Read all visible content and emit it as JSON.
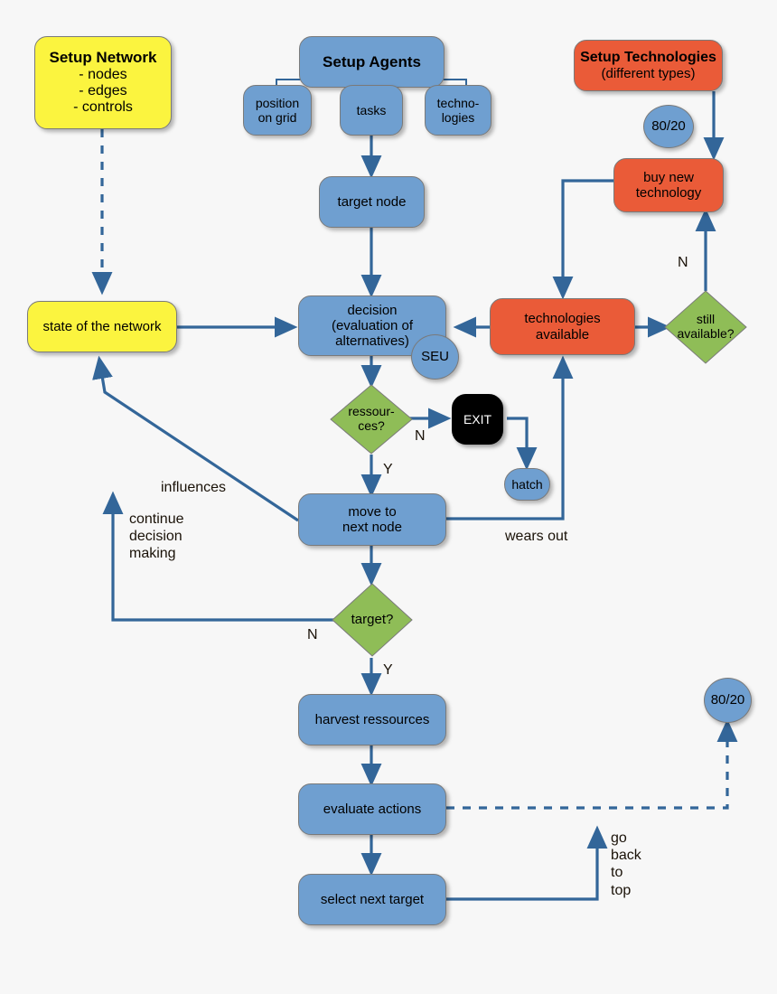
{
  "diagram": {
    "title_nodes": {
      "setup_network": {
        "title": "Setup Network",
        "lines": "- nodes\n- edges\n- controls"
      },
      "setup_agents": {
        "title": "Setup Agents"
      },
      "setup_technologies": {
        "title": "Setup Technologies",
        "sub": "(different types)"
      }
    },
    "nodes": [
      {
        "id": "setup-network",
        "label": "Setup Network",
        "shape": "rect",
        "color": "#fbf43f"
      },
      {
        "id": "setup-agents",
        "label": "Setup Agents",
        "shape": "rect",
        "color": "#6f9fd0"
      },
      {
        "id": "position-on-grid",
        "label": "position\non grid",
        "shape": "rect",
        "color": "#6f9fd0"
      },
      {
        "id": "tasks",
        "label": "tasks",
        "shape": "rect",
        "color": "#6f9fd0"
      },
      {
        "id": "technologies",
        "label": "techno-\nlogies",
        "shape": "rect",
        "color": "#6f9fd0"
      },
      {
        "id": "setup-technologies",
        "label": "Setup Technologies",
        "shape": "rect",
        "color": "#ea5b38"
      },
      {
        "id": "pareto-top",
        "label": "80/20",
        "shape": "circle",
        "color": "#6f9fd0"
      },
      {
        "id": "buy-new-technology",
        "label": "buy new\ntechnology",
        "shape": "rect",
        "color": "#ea5b38"
      },
      {
        "id": "target-node",
        "label": "target node",
        "shape": "rect",
        "color": "#6f9fd0"
      },
      {
        "id": "state-of-network",
        "label": "state of the network",
        "shape": "rect",
        "color": "#fbf43f"
      },
      {
        "id": "decision",
        "label": "decision\n(evaluation of\nalternatives)",
        "shape": "rect",
        "color": "#6f9fd0"
      },
      {
        "id": "seu",
        "label": "SEU",
        "shape": "circle",
        "color": "#6f9fd0"
      },
      {
        "id": "technologies-available",
        "label": "technologies\navailable",
        "shape": "rect",
        "color": "#ea5b38"
      },
      {
        "id": "still-available",
        "label": "still\navailable?",
        "shape": "diamond",
        "color": "#8fbd57"
      },
      {
        "id": "ressources",
        "label": "ressour-\nces?",
        "shape": "diamond",
        "color": "#8fbd57"
      },
      {
        "id": "exit",
        "label": "EXIT",
        "shape": "rect",
        "color": "#000000"
      },
      {
        "id": "hatch",
        "label": "hatch",
        "shape": "rect",
        "color": "#6f9fd0"
      },
      {
        "id": "move-to-next-node",
        "label": "move to\nnext node",
        "shape": "rect",
        "color": "#6f9fd0"
      },
      {
        "id": "target",
        "label": "target?",
        "shape": "diamond",
        "color": "#8fbd57"
      },
      {
        "id": "harvest-ressources",
        "label": "harvest ressources",
        "shape": "rect",
        "color": "#6f9fd0"
      },
      {
        "id": "evaluate-actions",
        "label": "evaluate actions",
        "shape": "rect",
        "color": "#6f9fd0"
      },
      {
        "id": "select-next-target",
        "label": "select next target",
        "shape": "rect",
        "color": "#6f9fd0"
      },
      {
        "id": "pareto-bottom",
        "label": "80/20",
        "shape": "circle",
        "color": "#6f9fd0"
      }
    ],
    "node_labels": {
      "setup_network_title": "Setup Network",
      "setup_network_items": "- nodes\n- edges\n- controls",
      "setup_agents": "Setup Agents",
      "position_on_grid": "position\non grid",
      "tasks": "tasks",
      "technologies": "techno-\nlogies",
      "setup_technologies_title": "Setup Technologies",
      "setup_technologies_sub": "(different types)",
      "pareto_top": "80/20",
      "buy_new_technology": "buy new\ntechnology",
      "target_node": "target node",
      "state_of_network": "state of the network",
      "decision": "decision\n(evaluation of\nalternatives)",
      "seu": "SEU",
      "technologies_available": "technologies\navailable",
      "still_available": "still\navailable?",
      "ressources": "ressour-\nces?",
      "exit": "EXIT",
      "hatch": "hatch",
      "move_to_next_node": "move to\nnext node",
      "target": "target?",
      "harvest_ressources": "harvest ressources",
      "evaluate_actions": "evaluate actions",
      "select_next_target": "select next target",
      "pareto_bottom": "80/20"
    },
    "edge_labels": {
      "n_still_available": "N",
      "n_ressources": "N",
      "y_ressources": "Y",
      "n_target": "N",
      "y_target": "Y",
      "influences": "influences",
      "continue_decision_making": "continue\ndecision\nmaking",
      "wears_out": "wears out",
      "go_back_to_top": "go\nback\nto\ntop"
    },
    "colors": {
      "blue": "#6f9fd0",
      "yellow": "#fbf43f",
      "orange": "#ea5b38",
      "green": "#8fbd57",
      "black": "#000000",
      "edge": "#336699",
      "background": "#f7f7f7"
    }
  }
}
